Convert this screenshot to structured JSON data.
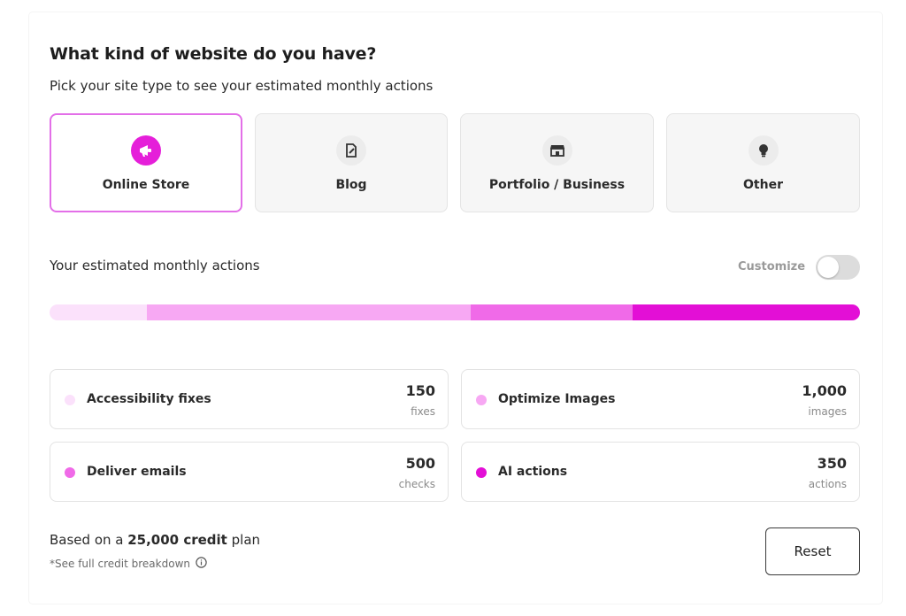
{
  "header": {
    "title": "What kind of website do you have?",
    "subtitle": "Pick your site type to see your estimated monthly actions"
  },
  "site_types": [
    {
      "label": "Online Store",
      "icon": "megaphone-icon",
      "selected": true
    },
    {
      "label": "Blog",
      "icon": "document-edit-icon",
      "selected": false
    },
    {
      "label": "Portfolio / Business",
      "icon": "storefront-icon",
      "selected": false
    },
    {
      "label": "Other",
      "icon": "lightbulb-icon",
      "selected": false
    }
  ],
  "estimate": {
    "label": "Your estimated monthly actions",
    "customize_label": "Customize",
    "customize_on": false
  },
  "usage_bar": {
    "segments": [
      {
        "metric": "Accessibility fixes",
        "fraction": 0.12,
        "color": "#fbe1fb"
      },
      {
        "metric": "Optimize Images",
        "fraction": 0.4,
        "color": "#f7a8f3"
      },
      {
        "metric": "Deliver emails",
        "fraction": 0.2,
        "color": "#f06ae8"
      },
      {
        "metric": "AI actions",
        "fraction": 0.28,
        "color": "#e30fd6"
      }
    ]
  },
  "metrics": [
    {
      "name": "Accessibility fixes",
      "value": "150",
      "unit": "fixes",
      "color": "#fbe1fb"
    },
    {
      "name": "Optimize Images",
      "value": "1,000",
      "unit": "images",
      "color": "#f7a8f3"
    },
    {
      "name": "Deliver emails",
      "value": "500",
      "unit": "checks",
      "color": "#f06ae8"
    },
    {
      "name": "AI actions",
      "value": "350",
      "unit": "actions",
      "color": "#e30fd6"
    }
  ],
  "footer": {
    "plan_prefix": "Based on a ",
    "plan_amount": "25,000 credit",
    "plan_suffix": " plan",
    "breakdown_link": "*See full credit breakdown",
    "reset_label": "Reset"
  },
  "colors": {
    "accent": "#e51fd9",
    "selected_border": "#e36fe8"
  }
}
